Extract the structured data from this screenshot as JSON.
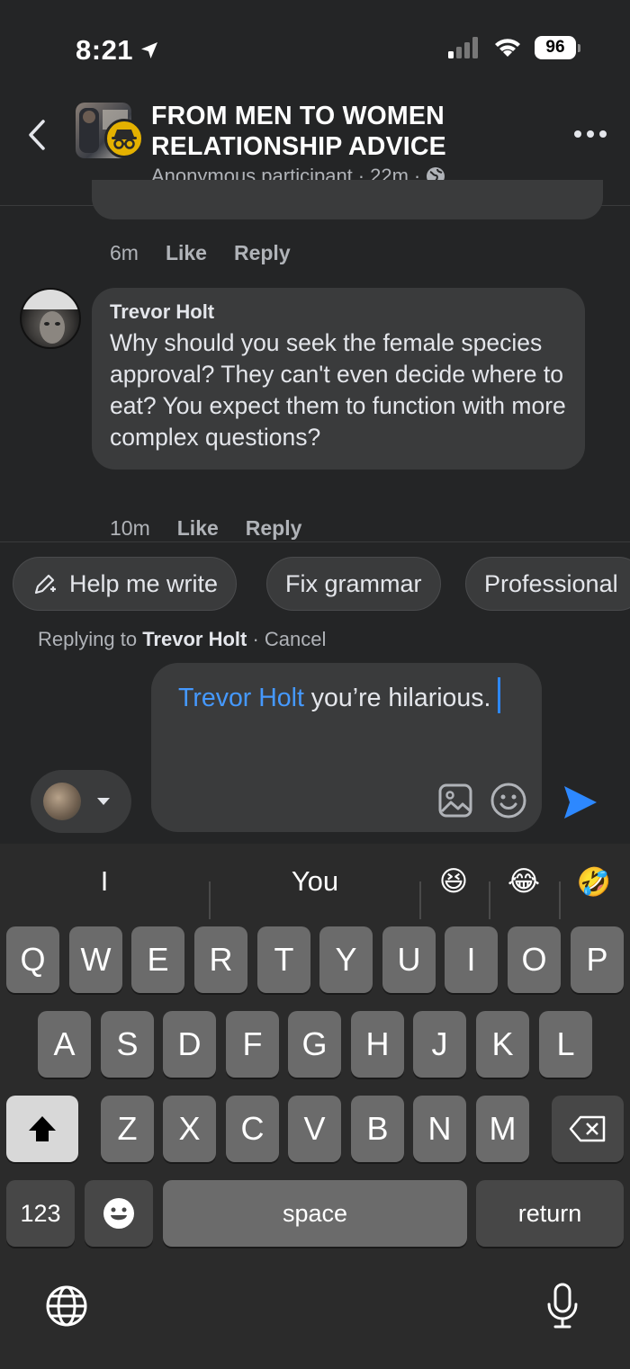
{
  "status_bar": {
    "time": "8:21",
    "battery": "96"
  },
  "header": {
    "title": "FROM MEN TO WOMEN RELATIONSHIP ADVICE",
    "subtitle_author": "Anonymous participant",
    "subtitle_time": "22m"
  },
  "previous_comment": {
    "time": "6m",
    "like_label": "Like",
    "reply_label": "Reply"
  },
  "comment": {
    "author": "Trevor Holt",
    "text": "Why should you seek the female species approval? They can't even decide where to eat? You expect them to function with more complex questions?",
    "time": "10m",
    "like_label": "Like",
    "reply_label": "Reply"
  },
  "ai_chips": {
    "help": "Help me write",
    "grammar": "Fix grammar",
    "professional": "Professional"
  },
  "replying": {
    "prefix": "Replying to",
    "name": "Trevor Holt",
    "cancel": "Cancel"
  },
  "composer": {
    "mention": "Trevor Holt",
    "text": " you’re hilarious."
  },
  "keyboard": {
    "suggestions": [
      "I",
      "You"
    ],
    "emoji_suggestions": [
      "😆",
      "😂",
      "🤣"
    ],
    "row1": [
      "Q",
      "W",
      "E",
      "R",
      "T",
      "Y",
      "U",
      "I",
      "O",
      "P"
    ],
    "row2": [
      "A",
      "S",
      "D",
      "F",
      "G",
      "H",
      "J",
      "K",
      "L"
    ],
    "row3": [
      "Z",
      "X",
      "C",
      "V",
      "B",
      "N",
      "M"
    ],
    "numbers_label": "123",
    "space_label": "space",
    "return_label": "return"
  },
  "colors": {
    "background": "#242526",
    "bubble": "#3a3b3c",
    "mention": "#4599ff",
    "send": "#2d88ff",
    "anon_badge": "#e4b100"
  }
}
